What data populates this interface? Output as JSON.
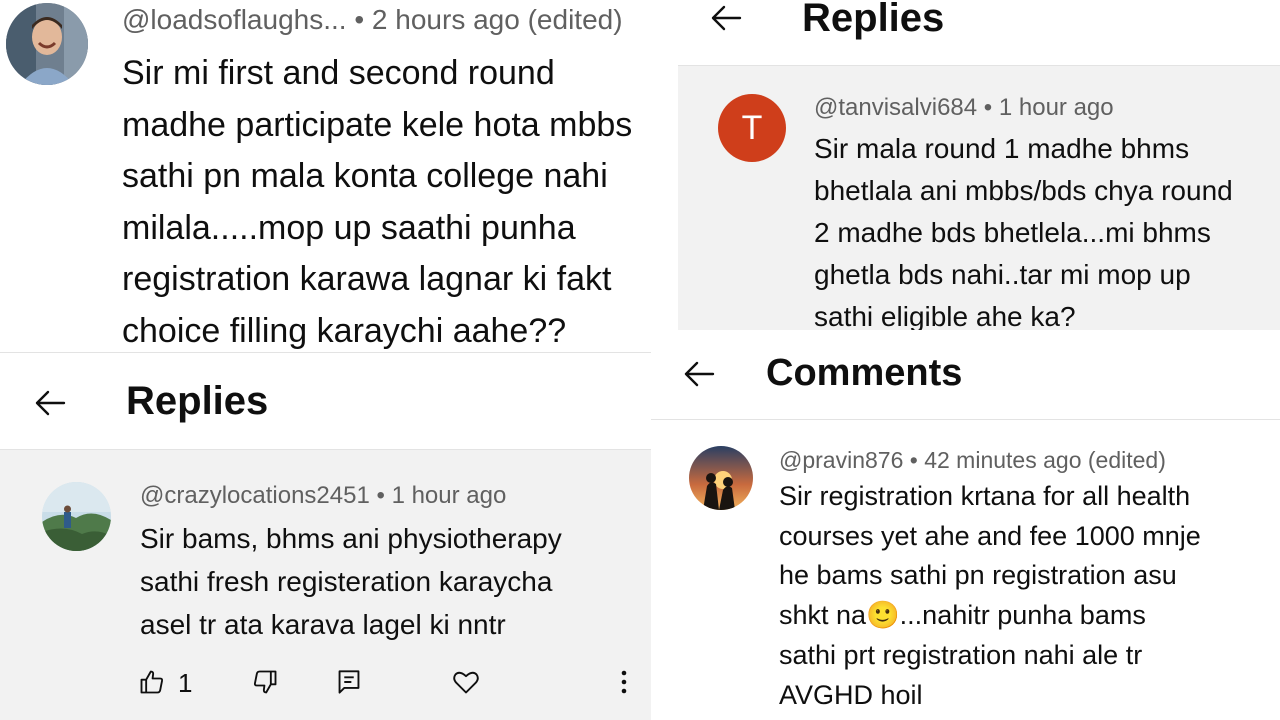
{
  "panel_a": {
    "author": "@loadsoflaughs...",
    "meta": "• 2 hours ago (edited)",
    "lines": [
      "Sir mi first and second round",
      "madhe participate kele hota mbbs",
      "sathi pn mala konta college nahi",
      "milala.....mop up saathi punha",
      "registration karawa lagnar ki fakt",
      "choice filling karaychi aahe??"
    ]
  },
  "panel_b": {
    "title": "Replies",
    "author": "@crazylocations2451",
    "meta": "• 1 hour ago",
    "lines": [
      "Sir bams, bhms ani physiotherapy",
      "sathi  fresh registeration karaycha",
      "asel tr ata karava lagel ki nntr"
    ],
    "like_count": "1"
  },
  "panel_c": {
    "title": "Replies",
    "avatar_letter": "T",
    "author": "@tanvisalvi684",
    "meta": "• 1 hour ago",
    "lines": [
      "Sir mala round 1 madhe bhms",
      "bhetlala ani mbbs/bds chya round",
      "2 madhe bds bhetlela...mi bhms",
      "ghetla bds nahi..tar mi mop up",
      "sathi eligible ahe ka?"
    ]
  },
  "panel_d": {
    "title": "Comments",
    "author": "@pravin876",
    "meta": "• 42 minutes ago (edited)",
    "lines": [
      "Sir registration krtana for all health",
      "courses yet ahe and fee 1000 mnje",
      "he bams sathi pn registration asu",
      "shkt na🙂...nahitr punha bams",
      "sathi prt registration nahi ale tr",
      "AVGHD hoil"
    ]
  },
  "colors": {
    "avatar_t": "#cf3e1b",
    "meta_text": "#606060",
    "reply_bg": "#f2f2f2"
  }
}
